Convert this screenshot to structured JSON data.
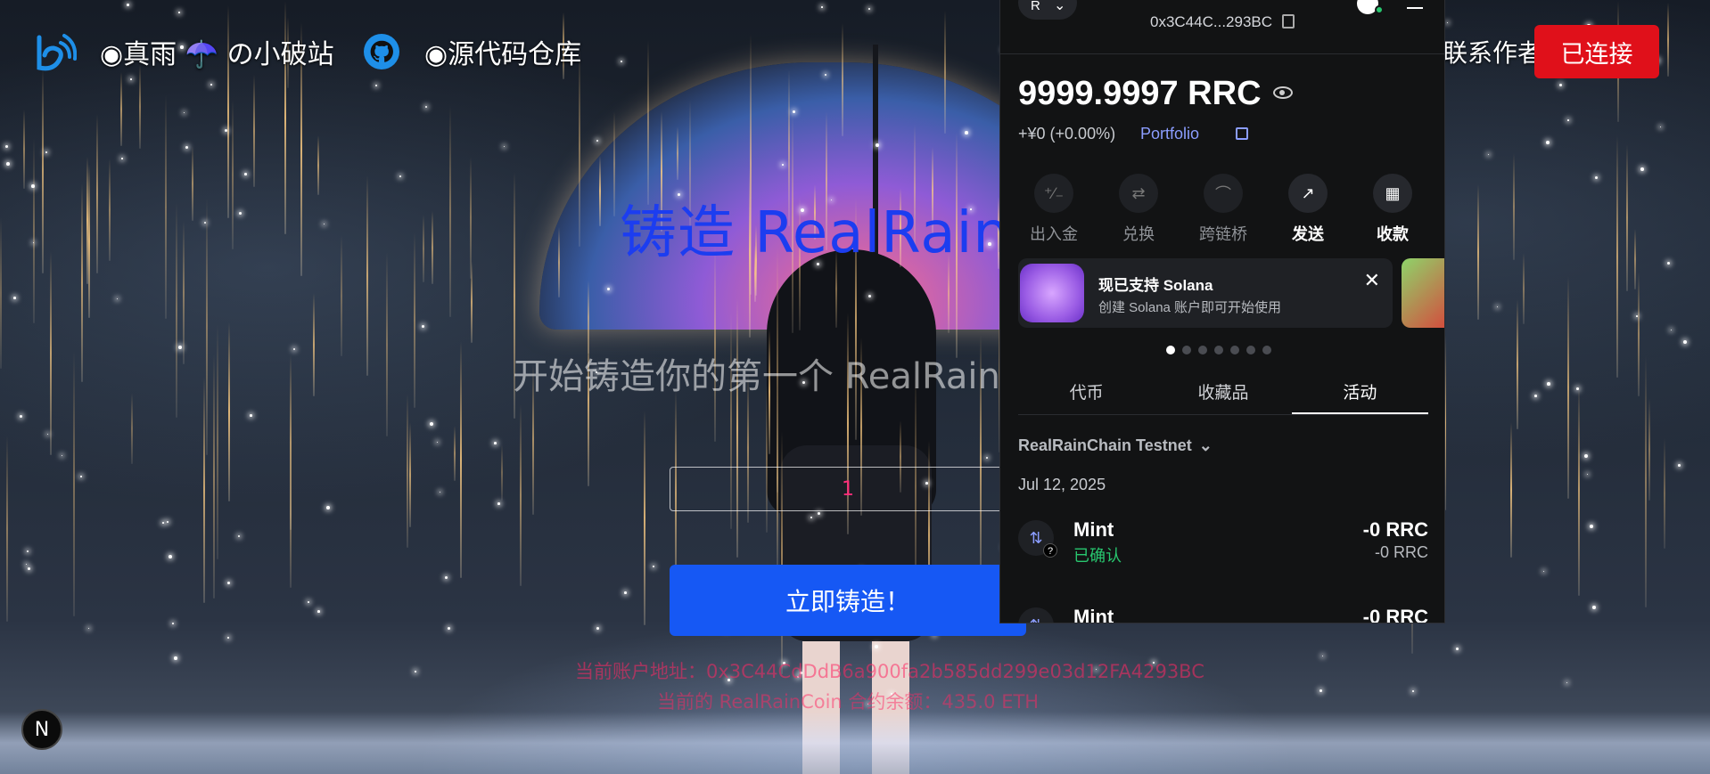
{
  "nav": {
    "link1": "◉真雨 ☂️ の小破站",
    "link2": "◉源代码仓库",
    "author": "联系作者",
    "connected_label": "已连接"
  },
  "hero": {
    "title": "铸造 RealRainC",
    "subtitle": "开始铸造你的第一个 RealRainC",
    "amount_value": "1",
    "mint_label": "立即铸造！",
    "account_line": "当前账户地址：0x3C44CdDdB6a900fa2b585dd299e03d12FA4293BC",
    "contract_line": "当前的 RealRainCoin 合约余额：435.0 ETH",
    "n_badge": "N"
  },
  "wallet": {
    "account_initial": "R",
    "address": "0x3C44C...293BC",
    "balance": "9999.9997 RRC",
    "change": "+¥0 (+0.00%)",
    "portfolio": "Portfolio",
    "actions": [
      {
        "label": "出入金",
        "icon": "⁺∕₋"
      },
      {
        "label": "兑换",
        "icon": "⇄"
      },
      {
        "label": "跨链桥",
        "icon": "⌒"
      },
      {
        "label": "发送",
        "icon": "↗"
      },
      {
        "label": "收款",
        "icon": "▦"
      }
    ],
    "banner_title": "现已支持 Solana",
    "banner_text": "创建 Solana 账户即可开始使用",
    "tabs": [
      "代币",
      "收藏品",
      "活动"
    ],
    "network": "RealRainChain Testnet",
    "date": "Jul 12, 2025",
    "transactions": [
      {
        "name": "Mint",
        "status": "已确认",
        "amount": "-0 RRC",
        "amount2": "-0 RRC"
      },
      {
        "name": "Mint",
        "status": "",
        "amount": "-0 RRC",
        "amount2": ""
      }
    ],
    "colors": {
      "accent": "#8b9dff",
      "confirmed": "#28c76f",
      "panel": "#121314"
    }
  },
  "colors": {
    "connected_button": "#e0101a",
    "mint_button": "#1658f4",
    "title": "#1c3df0"
  }
}
